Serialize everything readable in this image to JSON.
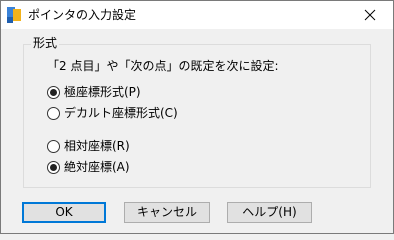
{
  "window": {
    "title": "ポインタの入力設定",
    "close_icon": "close-icon"
  },
  "group": {
    "legend": "形式",
    "description": "「2 点目」や「次の点」の既定を次に設定:"
  },
  "format_options": [
    {
      "label": "極座標形式(P)",
      "checked": true
    },
    {
      "label": "デカルト座標形式(C)",
      "checked": false
    }
  ],
  "coord_options": [
    {
      "label": "相対座標(R)",
      "checked": false
    },
    {
      "label": "絶対座標(A)",
      "checked": true
    }
  ],
  "buttons": {
    "ok": "OK",
    "cancel": "キャンセル",
    "help": "ヘルプ(H)"
  },
  "colors": {
    "default_button_border": "#0078d7"
  }
}
